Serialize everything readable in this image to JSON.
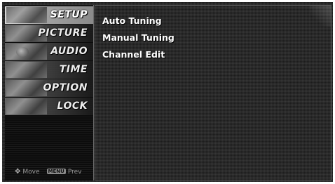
{
  "menu": {
    "items": [
      {
        "label": "SETUP",
        "selected": true
      },
      {
        "label": "PICTURE",
        "selected": false
      },
      {
        "label": "AUDIO",
        "selected": false
      },
      {
        "label": "TIME",
        "selected": false
      },
      {
        "label": "OPTION",
        "selected": false
      },
      {
        "label": "LOCK",
        "selected": false
      }
    ]
  },
  "submenu": {
    "items": [
      "Auto Tuning",
      "Manual Tuning",
      "Channel Edit"
    ]
  },
  "footer": {
    "move_icon": "arrows-icon",
    "move_label": "Move",
    "menu_key": "MENU",
    "prev_label": "Prev"
  }
}
